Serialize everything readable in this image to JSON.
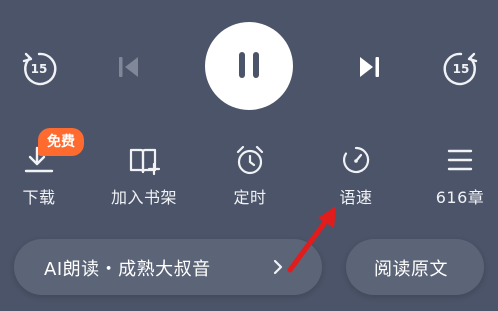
{
  "controls": {
    "rewind_seconds": "15",
    "forward_seconds": "15"
  },
  "actions": {
    "free_badge": "免费",
    "download_label": "下载",
    "bookshelf_label": "加入书架",
    "timer_label": "定时",
    "speed_label": "语速",
    "chapters_label": "616章"
  },
  "bottom": {
    "voice_label": "AI朗读・成熟大叔音",
    "read_original_label": "阅读原文"
  },
  "colors": {
    "background": "#4b5468",
    "pill": "#5c6477",
    "badge": "#ff6a2e",
    "arrow": "#e21c1c"
  }
}
